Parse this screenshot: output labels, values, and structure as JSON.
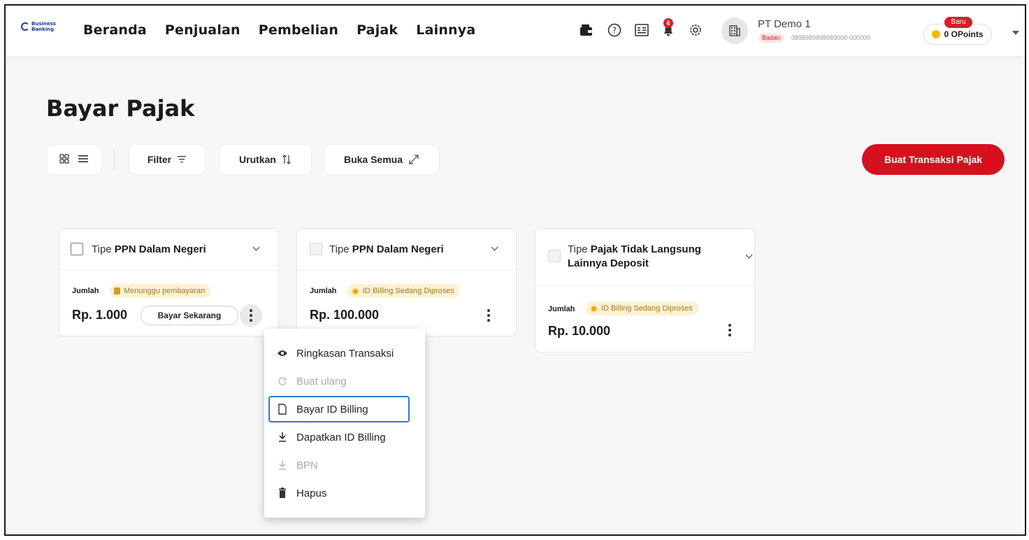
{
  "brand": {
    "logo_line1": "Business",
    "logo_line2": "Banking"
  },
  "nav": {
    "items": [
      "Beranda",
      "Penjualan",
      "Pembelian",
      "Pajak",
      "Lainnya"
    ]
  },
  "topbar": {
    "notification_count": "6",
    "company_name": "PT Demo 1",
    "company_type": "Badan",
    "company_npwp": "0898989898989000-000000",
    "points_label": "0 OPoints",
    "new_badge": "Baru"
  },
  "page": {
    "title": "Bayar Pajak"
  },
  "toolbar": {
    "filter_label": "Filter",
    "sort_label": "Urutkan",
    "expand_label": "Buka Semua",
    "create_label": "Buat Transaksi Pajak"
  },
  "cards": [
    {
      "type_prefix": "Tipe ",
      "type_name": "PPN Dalam Negeri",
      "amount_label": "Jumlah",
      "status": "Menunggu pembayaran",
      "amount": "Rp. 1.000",
      "pay_label": "Bayar Sekarang"
    },
    {
      "type_prefix": "Tipe ",
      "type_name": "PPN Dalam Negeri",
      "amount_label": "Jumlah",
      "status": "ID Billing Sedang Diproses",
      "amount": "Rp. 100.000"
    },
    {
      "type_prefix": "Tipe ",
      "type_name_line1": "Pajak Tidak Langsung",
      "type_name_line2": "Lainnya Deposit",
      "amount_label": "Jumlah",
      "status": "ID Billing Sedang Diproses",
      "amount": "Rp. 10.000"
    }
  ],
  "menu": {
    "items": [
      {
        "label": "Ringkasan Transaksi",
        "icon": "eye-icon",
        "enabled": true
      },
      {
        "label": "Buat ulang",
        "icon": "refresh-icon",
        "enabled": false
      },
      {
        "label": "Bayar ID Billing",
        "icon": "document-icon",
        "enabled": true,
        "highlighted": true
      },
      {
        "label": "Dapatkan ID Billing",
        "icon": "download-icon",
        "enabled": true
      },
      {
        "label": "BPN",
        "icon": "download-icon",
        "enabled": false
      },
      {
        "label": "Hapus",
        "icon": "trash-icon",
        "enabled": true
      }
    ]
  },
  "colors": {
    "accent_red": "#d6101f",
    "status_bg": "#fdf1d4",
    "highlight_blue": "#2a7bd1"
  }
}
